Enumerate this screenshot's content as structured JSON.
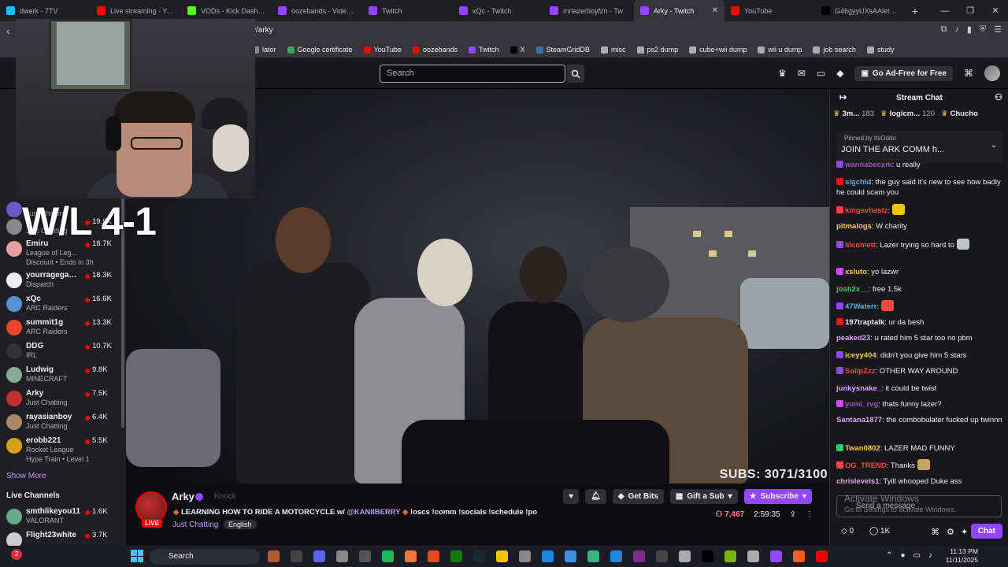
{
  "browser": {
    "tabs": [
      {
        "title": "dwerk - 7TV",
        "color": "#29b6f6"
      },
      {
        "title": "Live streaming - YouTube",
        "color": "#ff0000"
      },
      {
        "title": "VODs - Kick Dashboard",
        "color": "#53fc18"
      },
      {
        "title": "oozebands - Video Pro",
        "color": "#9147ff"
      },
      {
        "title": "Twitch",
        "color": "#9147ff"
      },
      {
        "title": "xQc - Twitch",
        "color": "#9147ff"
      },
      {
        "title": "mrlazerboyfzn - Tw",
        "color": "#9147ff"
      },
      {
        "title": "Arky - Twitch",
        "color": "#9147ff"
      },
      {
        "title": "YouTube",
        "color": "#ff0000"
      },
      {
        "title": "G46gyyUXsAAlet4 (68",
        "color": "#000000"
      }
    ],
    "active_tab_close": "✕",
    "new_tab": "+",
    "url": "v/arky",
    "bookmarks": [
      {
        "label": "lator",
        "color": "#888"
      },
      {
        "label": "Google certificate",
        "color": "#34a853"
      },
      {
        "label": "YouTube",
        "color": "#ff0000"
      },
      {
        "label": "oozebands",
        "color": "#ff0000"
      },
      {
        "label": "Twitch",
        "color": "#9147ff"
      },
      {
        "label": "X",
        "color": "#000"
      },
      {
        "label": "SteamGridDB",
        "color": "#3a6ea5"
      },
      {
        "label": "misc",
        "color": "#aaa"
      },
      {
        "label": "ps2 dump",
        "color": "#aaa"
      },
      {
        "label": "cube+wii dump",
        "color": "#aaa"
      },
      {
        "label": "wii u dump",
        "color": "#aaa"
      },
      {
        "label": "job search",
        "color": "#aaa"
      },
      {
        "label": "study",
        "color": "#aaa"
      }
    ]
  },
  "twitch": {
    "search_placeholder": "Search",
    "ad_free_label": "Go Ad-Free for Free",
    "sidebar": {
      "channels": [
        {
          "name": "",
          "game": "Just Chatting",
          "viewers": "",
          "color": "#6a5acd"
        },
        {
          "name": "",
          "game": "Just Chatting",
          "viewers": "19.6K",
          "color": "#888"
        },
        {
          "name": "Emiru",
          "game": "League of Leg...",
          "viewers": "18.7K",
          "extra": "Discount • Ends in 3h",
          "color": "#e3a0a0"
        },
        {
          "name": "yourragegami...",
          "game": "Dispatch",
          "viewers": "18.3K",
          "color": "#eee"
        },
        {
          "name": "xQc",
          "game": "ARC Raiders",
          "viewers": "16.6K",
          "color": "#5a8fd6"
        },
        {
          "name": "summit1g",
          "game": "ARC Raiders",
          "viewers": "13.3K",
          "color": "#e8452c"
        },
        {
          "name": "DDG",
          "game": "IRL",
          "viewers": "10.7K",
          "color": "#333"
        },
        {
          "name": "Ludwig",
          "game": "MINECRAFT",
          "viewers": "9.8K",
          "color": "#8a9"
        },
        {
          "name": "Arky",
          "game": "Just Chatting",
          "viewers": "7.5K",
          "color": "#c03030"
        },
        {
          "name": "rayasianboy",
          "game": "Just Chatting",
          "viewers": "6.4K",
          "color": "#a86"
        },
        {
          "name": "erobb221",
          "game": "Rocket League",
          "viewers": "5.5K",
          "extra": "Hype Train • Level 1",
          "color": "#d4a017"
        }
      ],
      "show_more": "Show More",
      "live_channels_heading": "Live Channels",
      "live": [
        {
          "name": "smthlikeyou11",
          "game": "VALORANT",
          "viewers": "1.6K",
          "color": "#6a8"
        },
        {
          "name": "Flight23white",
          "game": "",
          "viewers": "3.7K",
          "color": "#ccc"
        }
      ]
    },
    "overlay": {
      "wl_text": "W/L 4-1",
      "subs_text": "SUBS: 3071/3100"
    },
    "stream": {
      "streamer": "Arky",
      "knock_label": "Knock",
      "live_badge": "LIVE",
      "title_pre": "LEARNING HOW TO RIDE A MOTORCYCLE w/ ",
      "title_mention": "@KANIIBERRY",
      "title_post": " !oscs !comm !socials !schedule !po",
      "diamond": "◆",
      "category": "Just Chatting",
      "language": "English",
      "viewers": "7,467",
      "uptime": "2:59:35",
      "get_bits": "Get Bits",
      "gift_sub": "Gift a Sub",
      "subscribe": "Subscribe"
    },
    "chat": {
      "header": "Stream Chat",
      "leaderboard": [
        {
          "name": "3m...",
          "count": "183"
        },
        {
          "name": "logicm...",
          "count": "120"
        },
        {
          "name": "Chucho",
          "count": ""
        }
      ],
      "pinned_by": "Pinned by ItsOddo",
      "pinned_msg": "JOIN THE ARK COMM h...",
      "messages": [
        {
          "user": "wannabecxm",
          "color": "#9b59b6",
          "text": ": u really",
          "badge": "#9147ff"
        },
        {
          "user": "sigchld",
          "color": "#5dade2",
          "text": ": the guy said it's new to see how badly he could scam you",
          "badge": "#e91916"
        },
        {
          "user": "kingsvhastz",
          "color": "#e74c3c",
          "text": ":",
          "badge": "#ff4444"
        },
        {
          "user": "pitmalogs",
          "color": "#f7c948",
          "text": ": W charity",
          "badge": ""
        },
        {
          "user": "lilcomett",
          "color": "#e74c3c",
          "text": ": Lazer trying so hard to",
          "badge": "#9147ff"
        },
        {
          "user": "xsluto",
          "color": "#f7c948",
          "text": ": yo lazwr",
          "badge": "#d147ff"
        },
        {
          "user": "josh2x__",
          "color": "#2ecc71",
          "text": ": free 1.5k",
          "badge": ""
        },
        {
          "user": "47Waterr",
          "color": "#5dade2",
          "text": ":",
          "badge": "#9147ff"
        },
        {
          "user": "197traptalk",
          "color": "#efeff1",
          "text": ": ur da besh",
          "badge": "#e91916"
        },
        {
          "user": "peaked23",
          "color": "#e0a0ff",
          "text": ": u rated him 5 star too no pbm",
          "badge": ""
        },
        {
          "user": "iceyy404",
          "color": "#f7c948",
          "text": ": didn't you give him 5 stars",
          "badge": "#9147ff"
        },
        {
          "user": "SolipZzz",
          "color": "#e74c3c",
          "text": ": OTHER WAY AROUND",
          "badge": "#9147ff"
        },
        {
          "user": "junkysnake_",
          "color": "#e0a0ff",
          "text": ": it could be twist",
          "badge": ""
        },
        {
          "user": "yumi_rvg",
          "color": "#9b59b6",
          "text": ": thats funny lazer?",
          "badge": "#d147ff"
        },
        {
          "user": "Santana1877",
          "color": "#e0a0ff",
          "text": ": the combobulater fucked up twinnn",
          "badge": ""
        },
        {
          "user": "Twan0802",
          "color": "#f7c948",
          "text": ": LAZER MAD FUNNY",
          "badge": "#2ecc71"
        },
        {
          "user": "OG_TREND",
          "color": "#e74c3c",
          "text": ": Thanks",
          "badge": "#ff4444"
        },
        {
          "user": "chrislevels1",
          "color": "#e0a0ff",
          "text": ": Tyill whooped Duke ass",
          "badge": ""
        }
      ],
      "input_placeholder": "Send a message",
      "activate_title": "Activate Windows",
      "activate_sub": "Go to Settings to activate Windows.",
      "bits": "0",
      "points": "1K",
      "chat_button": "Chat"
    }
  },
  "taskbar": {
    "search": "Search",
    "time": "11:13 PM",
    "date": "11/11/2025",
    "notif": "2"
  },
  "icons": {
    "search": "search-icon",
    "heart": "heart-icon",
    "bell": "bell-icon",
    "more": "more-icon"
  }
}
